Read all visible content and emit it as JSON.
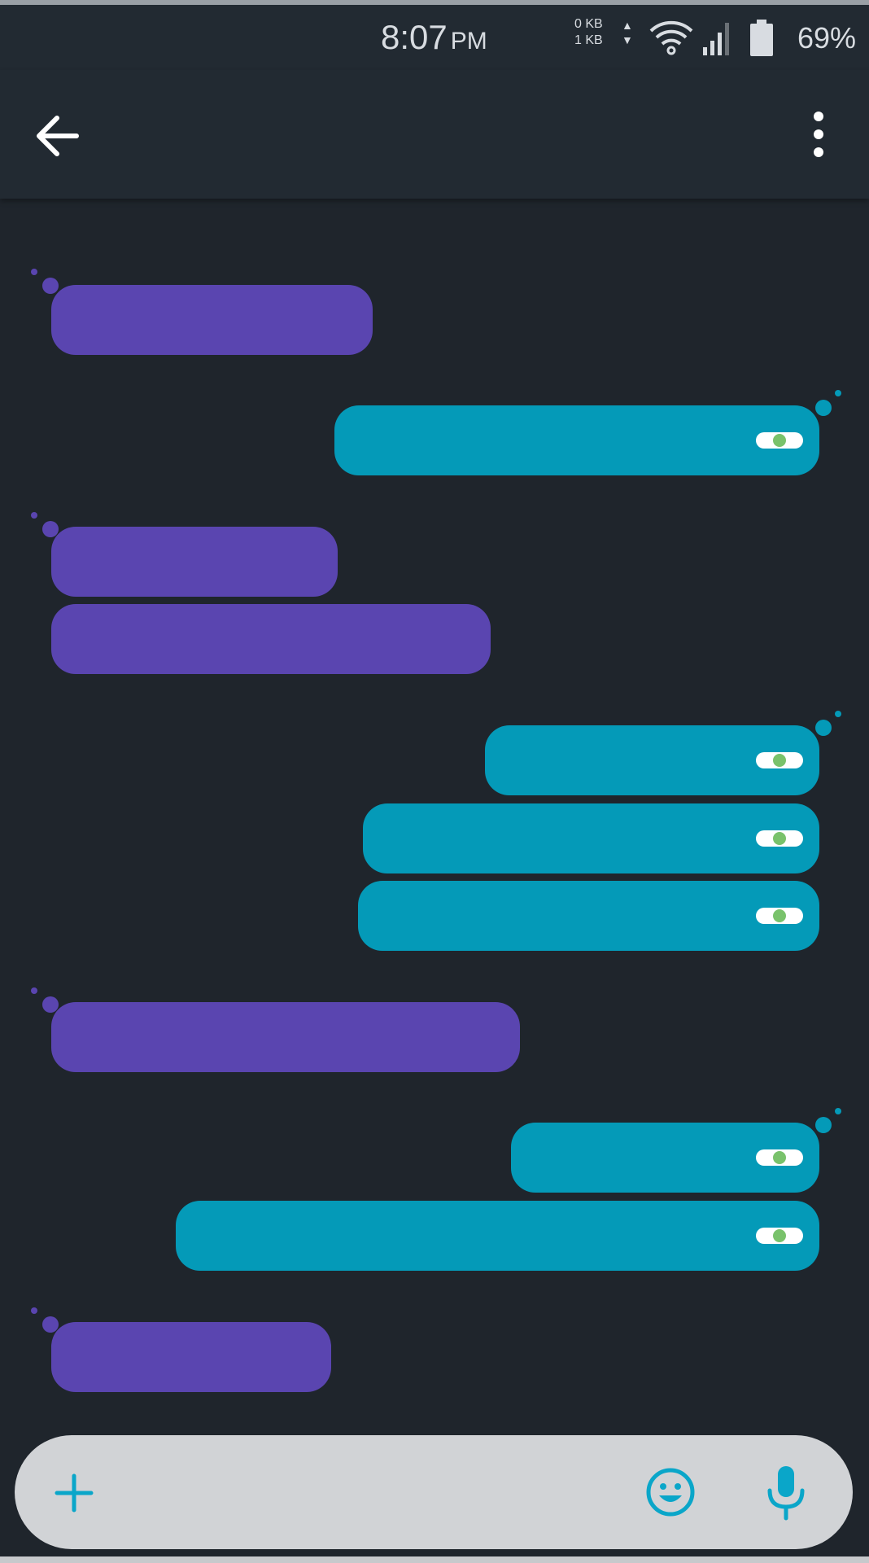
{
  "status_bar": {
    "time": "8:07",
    "ampm": "PM",
    "data_up": "0 KB",
    "data_down": "1 KB",
    "battery_percent": "69%",
    "icons": [
      "wifi-icon",
      "cellular-signal-icon",
      "battery-icon"
    ]
  },
  "app_bar": {
    "back_icon": "arrow-back-icon",
    "menu_icon": "more-vert-icon"
  },
  "messages": [
    {
      "direction": "received"
    },
    {
      "direction": "sent",
      "read": true
    },
    {
      "direction": "received"
    },
    {
      "direction": "received"
    },
    {
      "direction": "sent",
      "read": true
    },
    {
      "direction": "sent",
      "read": true
    },
    {
      "direction": "sent",
      "read": true
    },
    {
      "direction": "received"
    },
    {
      "direction": "sent",
      "read": true
    },
    {
      "direction": "sent",
      "read": true
    },
    {
      "direction": "received"
    }
  ],
  "composer": {
    "placeholder": "",
    "value": "",
    "icons": [
      "plus-icon",
      "emoji-icon",
      "microphone-icon"
    ]
  },
  "colors": {
    "background": "#1f252c",
    "app_bar": "#222a32",
    "received_bubble": "#5a45b0",
    "sent_bubble": "#049ab8",
    "read_indicator": "#79c26b",
    "accent": "#0aa6c9",
    "composer": "#d1d3d6"
  }
}
